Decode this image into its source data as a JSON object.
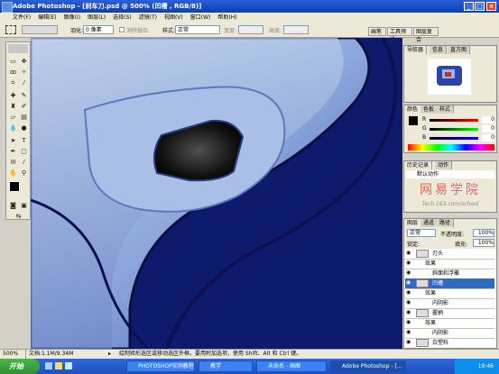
{
  "titlebar": {
    "title": "Adobe Photoshop - [刹车刀.psd @ 500% (凹槽 , RGB/8)]"
  },
  "menu": [
    "文件(F)",
    "编辑(E)",
    "图像(I)",
    "图层(L)",
    "选择(S)",
    "滤镜(T)",
    "视图(V)",
    "窗口(W)",
    "帮助(H)"
  ],
  "options": {
    "feather_label": "羽化:",
    "feather_value": "0 像素",
    "antialias_label": "消除锯齿",
    "style_label": "样式:",
    "style_value": "正常",
    "width_label": "宽度:",
    "height_label": "高度:"
  },
  "right_tabs": [
    "画笔",
    "工具预设",
    "图层复合"
  ],
  "navigator": {
    "tabs": [
      "导航器",
      "信息",
      "直方图"
    ]
  },
  "color": {
    "tabs": [
      "颜色",
      "色板",
      "样式"
    ],
    "channels": [
      {
        "label": "R",
        "value": "0"
      },
      {
        "label": "G",
        "value": "0"
      },
      {
        "label": "B",
        "value": "0"
      }
    ]
  },
  "history": {
    "tabs": [
      "历史记录",
      "动作"
    ],
    "default_action": "默认动作",
    "watermark": "网易学院",
    "watermark_url": "Tech.163.com/school"
  },
  "layers": {
    "tabs": [
      "图层",
      "通道",
      "路径"
    ],
    "blend_mode": "正常",
    "opacity_label": "不透明度:",
    "opacity_value": "100%",
    "lock_label": "锁定:",
    "fill_label": "填充:",
    "fill_value": "100%",
    "rows": [
      {
        "name": "刃头",
        "type": "layer",
        "active": false
      },
      {
        "name": "效果",
        "type": "effects",
        "active": false
      },
      {
        "name": "斜面和浮雕",
        "type": "effect",
        "active": false
      },
      {
        "name": "凹槽",
        "type": "layer",
        "active": true
      },
      {
        "name": "效果",
        "type": "effects",
        "active": false
      },
      {
        "name": "内阴影",
        "type": "effect",
        "active": false
      },
      {
        "name": "握柄",
        "type": "layer",
        "active": false
      },
      {
        "name": "效果",
        "type": "effects",
        "active": false
      },
      {
        "name": "内阴影",
        "type": "effect",
        "active": false
      },
      {
        "name": "白塑料",
        "type": "layer",
        "active": false
      }
    ]
  },
  "status": {
    "zoom": "500%",
    "doc": "文档:1.1M/9.34M",
    "hint": "绘制矩形选区或移动选区外框。要用附加选项，使用 Shift、Alt 和 Ctrl 键。"
  },
  "taskbar": {
    "start": "开始",
    "tasks": [
      {
        "label": "PHOTOSHOP实例教程",
        "active": false
      },
      {
        "label": "教学",
        "active": false
      },
      {
        "label": "未命名 - 画图",
        "active": false
      },
      {
        "label": "Adobe Photoshop - [...",
        "active": true
      }
    ],
    "clock": "19:46"
  }
}
